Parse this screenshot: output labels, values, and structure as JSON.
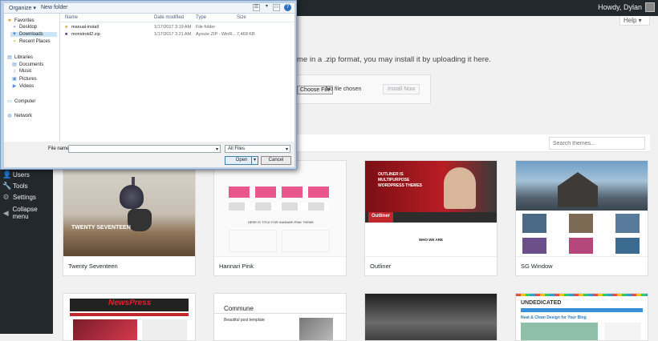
{
  "admin_bar": {
    "howdy": "Howdy, Dylan"
  },
  "help_label": "Help ▾",
  "sidebar": {
    "items": [
      {
        "label": "Users",
        "icon": "users-icon",
        "glyph": "👤"
      },
      {
        "label": "Tools",
        "icon": "tools-icon",
        "glyph": "🔧"
      },
      {
        "label": "Settings",
        "icon": "settings-icon",
        "glyph": "⚙"
      },
      {
        "label": "Collapse menu",
        "icon": "collapse-icon",
        "glyph": "◀"
      }
    ]
  },
  "upload": {
    "text": "me in a .zip format, you may install it by uploading it here.",
    "choose_label": "Choose File",
    "no_file": "No file chosen",
    "install_label": "Install Now"
  },
  "search": {
    "placeholder": "Search themes..."
  },
  "themes": [
    {
      "name": "Twenty Seventeen"
    },
    {
      "name": "Hannari Pink"
    },
    {
      "name": "Outliner"
    },
    {
      "name": "SG Window"
    }
  ],
  "theme_previews": {
    "twenty_seventeen": "TWENTY SEVENTEEN",
    "outliner_headline": "OUTLINER IS MULTIPURPOSE WORDPRESS THEMES",
    "outliner_logo": "Outliner",
    "outliner_section": "WHO WE ARE",
    "hannari_caption": "HERE IS TITLE FOR HANNARI PINK THEME",
    "newspress": "NewsPress",
    "commune": "Commune",
    "commune_sub": "Beautiful post template",
    "undedicated": "UNDEDICATED",
    "undedicated_tagline": "Neat & Clean Design for Your Blog"
  },
  "dialog": {
    "organize": "Organize ▾",
    "new_folder": "New folder",
    "nav": {
      "favorites": "Favorites",
      "desktop": "Desktop",
      "downloads": "Downloads",
      "recent": "Recent Places",
      "libraries": "Libraries",
      "documents": "Documents",
      "music": "Music",
      "pictures": "Pictures",
      "videos": "Videos",
      "computer": "Computer",
      "network": "Network"
    },
    "columns": {
      "name": "Name",
      "date": "Date modified",
      "type": "Type",
      "size": "Size"
    },
    "files": [
      {
        "name": "manual-install",
        "date": "1/17/2017 3:19 AM",
        "type": "File folder",
        "size": ""
      },
      {
        "name": "monstroid2.zip",
        "date": "1/17/2017 3:21 AM",
        "type": "Ayoute ZIP - WinR...",
        "size": "7,468 KB"
      }
    ],
    "file_name_label": "File name",
    "file_name_value": "",
    "file_type": "All Files",
    "open_label": "Open",
    "cancel_label": "Cancel"
  },
  "colors": {
    "accent": "#0073aa",
    "admin_bg": "#23282d"
  }
}
